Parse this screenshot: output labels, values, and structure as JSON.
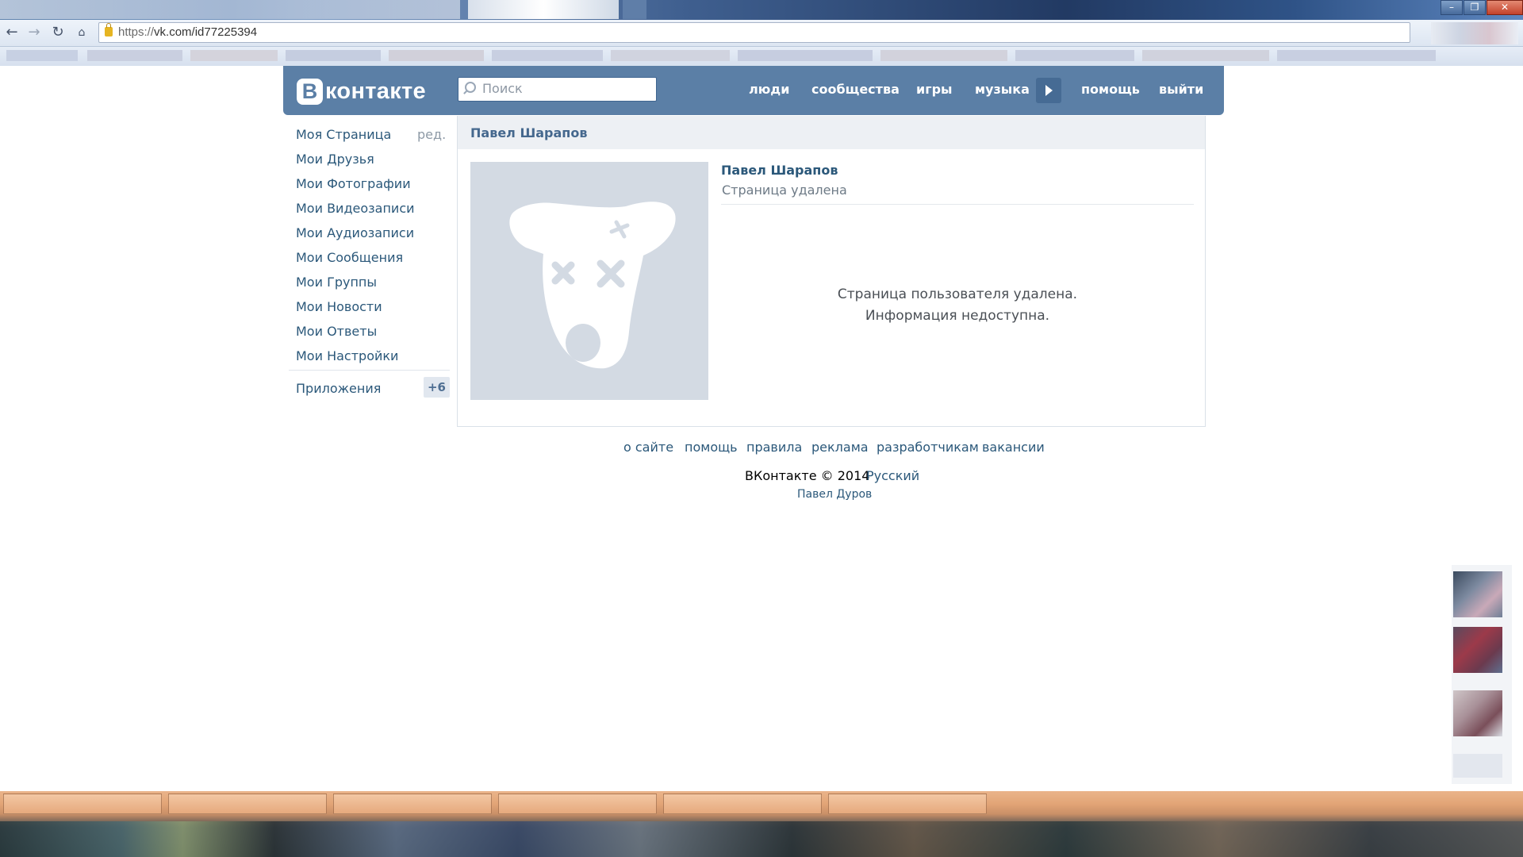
{
  "browser": {
    "url_scheme": "https://",
    "url_rest": "vk.com/id77225394",
    "window_buttons": [
      "–",
      "❐",
      "✕"
    ]
  },
  "header": {
    "logo_mark": "B",
    "logo_text": "контакте",
    "search_placeholder": "Поиск",
    "nav": [
      "люди",
      "сообщества",
      "игры",
      "музыка",
      "помощь",
      "выйти"
    ]
  },
  "left_menu": {
    "edit_label": "ред.",
    "items": [
      "Моя Страница",
      "Мои Друзья",
      "Мои Фотографии",
      "Мои Видеозаписи",
      "Мои Аудиозаписи",
      "Мои Сообщения",
      "Мои Группы",
      "Мои Новости",
      "Мои Ответы",
      "Мои Настройки"
    ],
    "apps_label": "Приложения",
    "apps_badge": "+6"
  },
  "profile": {
    "header_title": "Павел Шарапов",
    "name": "Павел Шарапов",
    "status": "Страница удалена",
    "message_line1": "Страница пользователя удалена.",
    "message_line2": "Информация недоступна."
  },
  "footer": {
    "links": [
      "о сайте",
      "помощь",
      "правила",
      "реклама",
      "разработчикам",
      "вакансии"
    ],
    "copyright": "ВКонтакте © 2014",
    "language": "Русский",
    "author": "Павел Дуров"
  },
  "colors": {
    "vk_header": "#5b7fa6",
    "link": "#2b587a",
    "taskbar": "#e2a476"
  },
  "icons": [
    "back-icon",
    "forward-icon",
    "reload-icon",
    "home-icon",
    "lock-icon",
    "search-icon",
    "play-icon",
    "deleted-dog-icon"
  ]
}
